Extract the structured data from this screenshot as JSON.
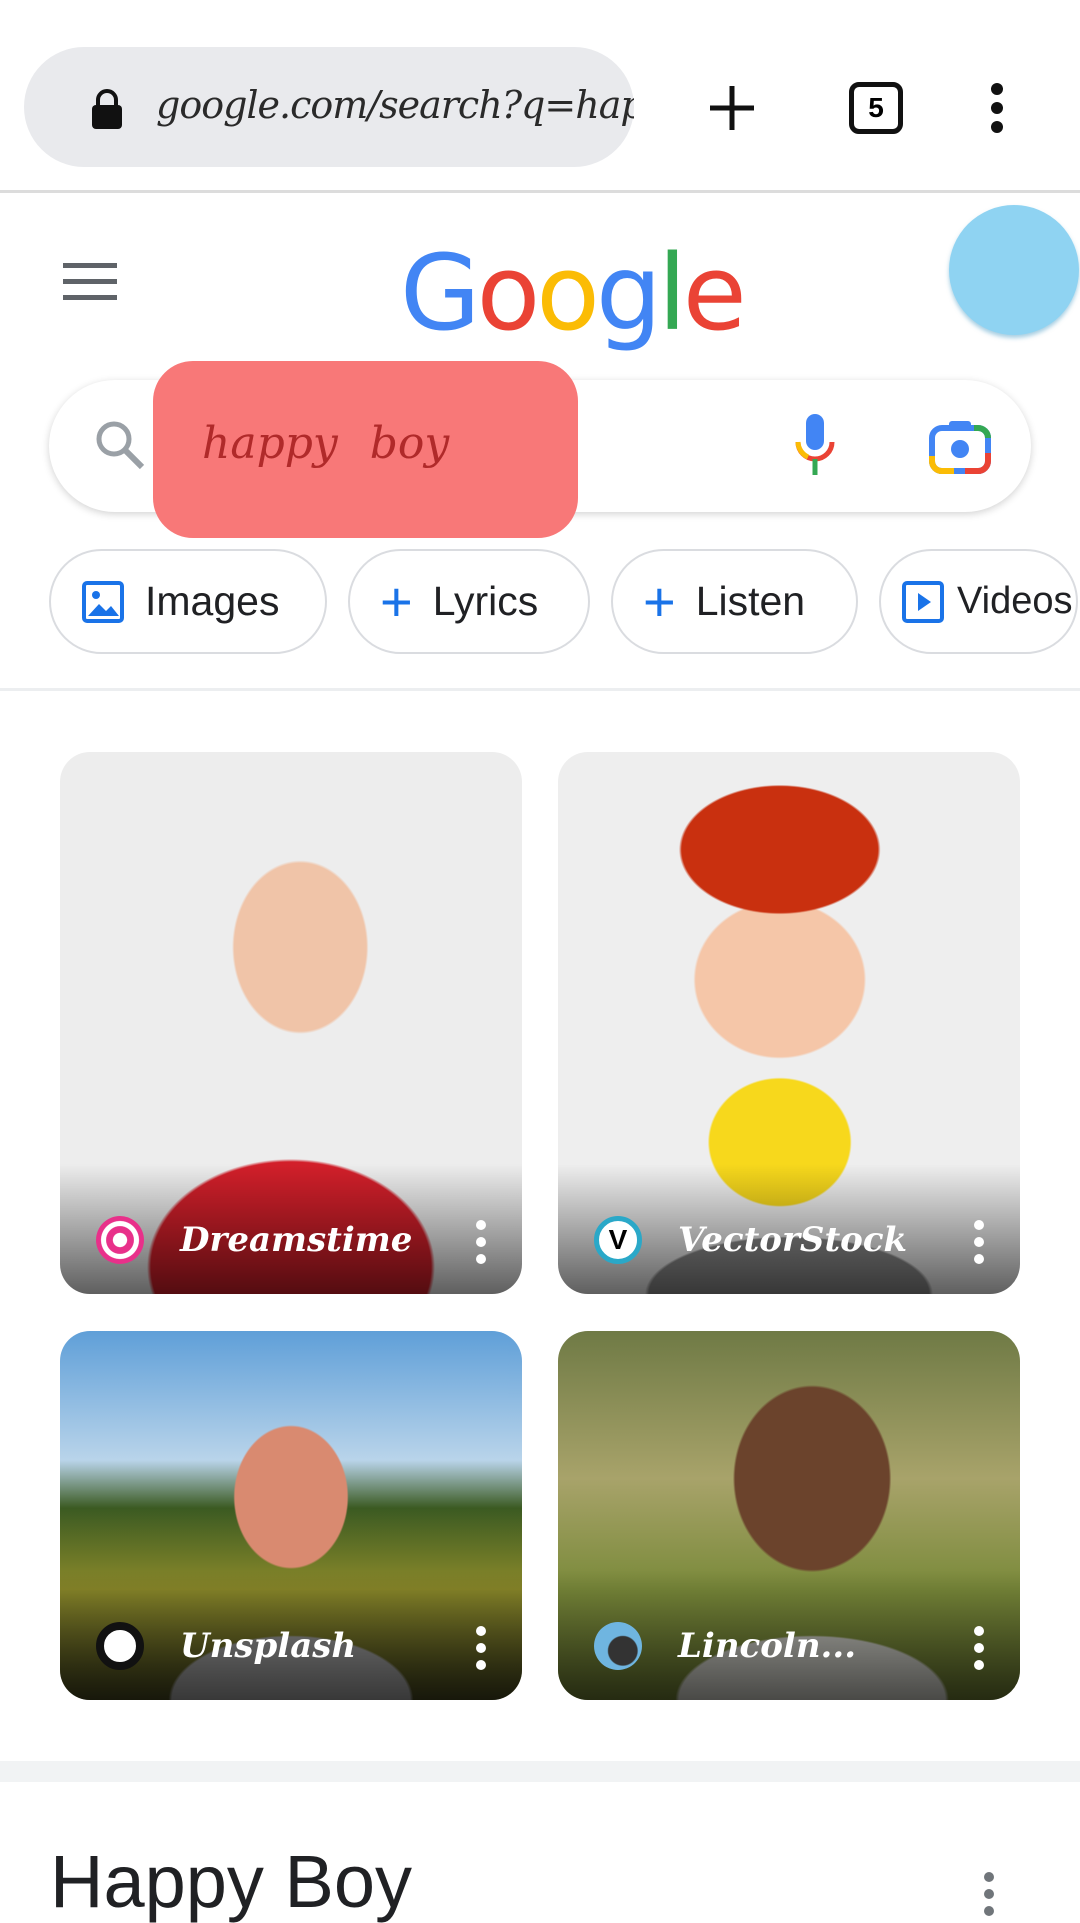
{
  "browser": {
    "url": "google.com/search?q=happy+",
    "tab_count": "5",
    "icons": [
      "lock-icon",
      "new-tab-plus-icon",
      "tab-switcher-icon",
      "more-vert-icon"
    ]
  },
  "header": {
    "logo": "Google",
    "avatar_color": "#8fd3f2"
  },
  "search": {
    "query": "happy  boy",
    "highlight_color": "#f87878"
  },
  "chips": [
    {
      "label": "Images",
      "icon": "image-icon"
    },
    {
      "label": "Lyrics",
      "icon": "plus-icon"
    },
    {
      "label": "Listen",
      "icon": "plus-icon"
    },
    {
      "label": "Videos",
      "icon": "play-icon"
    }
  ],
  "images": [
    {
      "source": "Dreamstime"
    },
    {
      "source": "VectorStock"
    },
    {
      "source": "Unsplash"
    },
    {
      "source": "Lincoln..."
    }
  ],
  "section": {
    "title": "Happy Boy"
  }
}
